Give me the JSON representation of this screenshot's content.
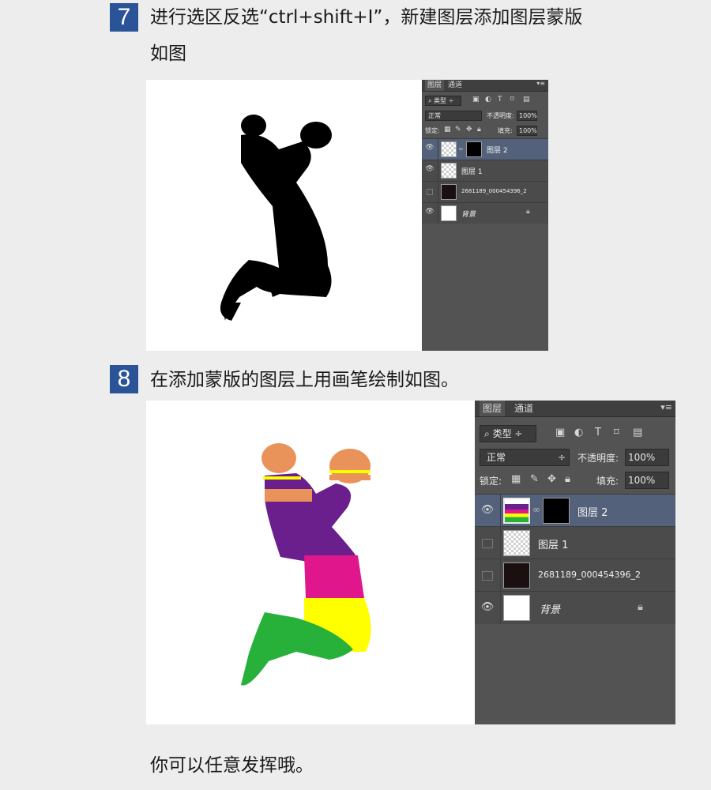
{
  "step7": {
    "number": "7",
    "line1": "进行选区反选“ctrl+shift+I”，新建图层添加图层蒙版",
    "line2": "如图"
  },
  "step8": {
    "number": "8",
    "text": "在添加蒙版的图层上用画笔绘制如图。"
  },
  "footer_text": "你可以任意发挥哦。",
  "panel": {
    "tab_layers": "图层",
    "tab_channels": "通道",
    "filter_kind": "类型",
    "blend_mode": "正常",
    "opacity_label": "不透明度:",
    "opacity_value": "100%",
    "lock_label": "锁定:",
    "fill_label": "填充:",
    "fill_value": "100%",
    "layers": [
      {
        "name": "图层 2",
        "selected": true,
        "visible": true
      },
      {
        "name": "图层 1",
        "selected": false,
        "visible": true
      },
      {
        "name": "2681189_000454396_2",
        "selected": false,
        "visible": false
      },
      {
        "name": "背景",
        "selected": false,
        "visible": true
      }
    ]
  },
  "panel2": {
    "layers": [
      {
        "name": "图层 2",
        "selected": true,
        "visible": true
      },
      {
        "name": "图层 1",
        "selected": false,
        "visible": false
      },
      {
        "name": "2681189_000454396_2",
        "selected": false,
        "visible": false
      },
      {
        "name": "背景",
        "selected": false,
        "visible": true
      }
    ]
  },
  "icons": {
    "eye": "eye-icon",
    "lock": "lock-icon",
    "link": "chain-link-icon",
    "search": "search-icon"
  },
  "colors": {
    "badge": "#2a5398",
    "ps_panel": "#535353",
    "selected_layer": "#54617a"
  }
}
